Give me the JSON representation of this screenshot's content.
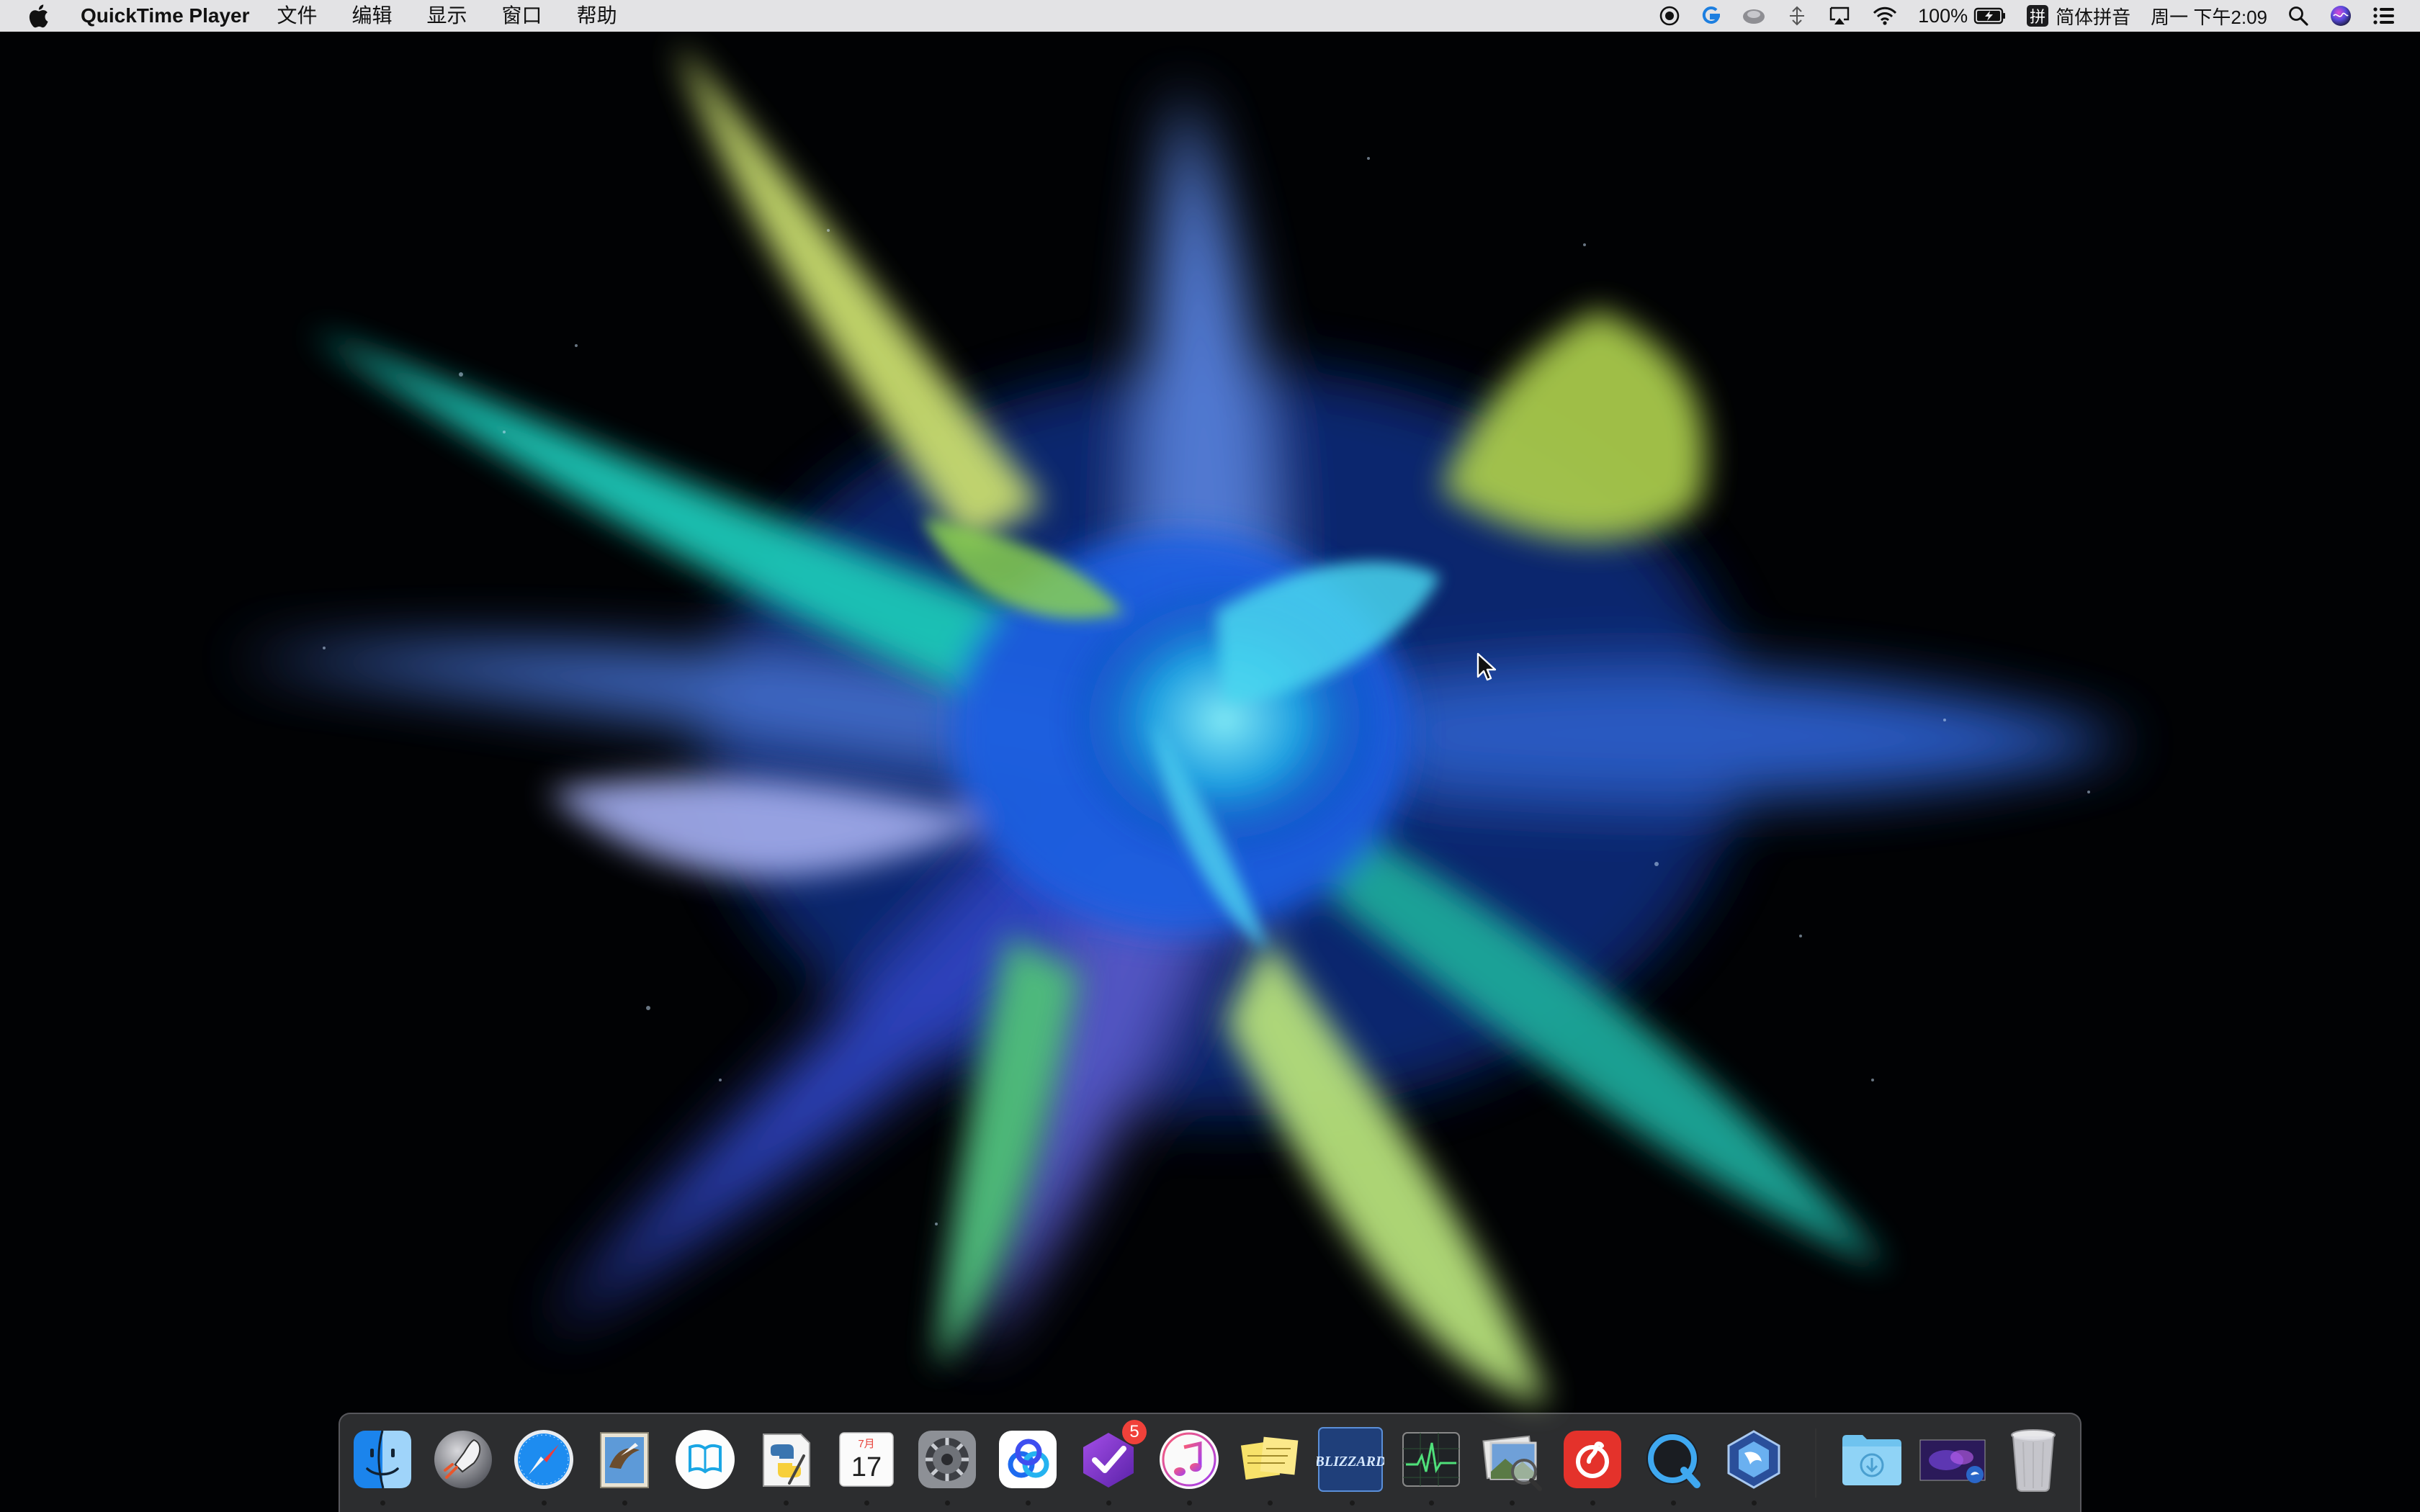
{
  "menubar": {
    "app_name": "QuickTime Player",
    "items": [
      "文件",
      "编辑",
      "显示",
      "窗口",
      "帮助"
    ],
    "battery_percent": "100%",
    "input_method_glyph": "拼",
    "input_method_label": "简体拼音",
    "clock": "周一 下午2:09"
  },
  "dock": {
    "apps": [
      {
        "name": "Finder",
        "icon": "finder-icon",
        "running": true
      },
      {
        "name": "Launchpad",
        "icon": "launchpad-icon",
        "running": false
      },
      {
        "name": "Safari",
        "icon": "safari-icon",
        "running": true
      },
      {
        "name": "Mail",
        "icon": "mail-icon",
        "running": true
      },
      {
        "name": "Reader",
        "icon": "reader-icon",
        "running": false
      },
      {
        "name": "Python Launcher",
        "icon": "python-icon",
        "running": true
      },
      {
        "name": "Calendar",
        "icon": "calendar-icon",
        "running": true
      },
      {
        "name": "System Preferences",
        "icon": "system-preferences-icon",
        "running": true
      },
      {
        "name": "Baidu Netdisk",
        "icon": "baidu-netdisk-icon",
        "running": true
      },
      {
        "name": "OmniFocus",
        "icon": "omnifocus-icon",
        "running": true
      },
      {
        "name": "iTunes",
        "icon": "itunes-icon",
        "running": true
      },
      {
        "name": "Stickies",
        "icon": "stickies-icon",
        "running": true
      },
      {
        "name": "Blizzard",
        "icon": "blizzard-icon",
        "running": true
      },
      {
        "name": "Activity Monitor",
        "icon": "activity-monitor-icon",
        "running": true
      },
      {
        "name": "Preview",
        "icon": "preview-icon",
        "running": true
      },
      {
        "name": "NetEase Music",
        "icon": "netease-music-icon",
        "running": true
      },
      {
        "name": "QuickTime Player",
        "icon": "quicktime-icon",
        "running": true
      },
      {
        "name": "Heroes of the Storm",
        "icon": "heroes-icon",
        "running": true
      }
    ],
    "calendar_month": "7月",
    "calendar_day": "17",
    "omnifocus_badge": "5",
    "blizzard_label": "BLIZZARD",
    "downloads": {
      "name": "Downloads",
      "icon": "downloads-folder-icon"
    },
    "stack": {
      "name": "Desktop Stack",
      "icon": "desktop-stack-icon"
    },
    "trash": {
      "name": "Trash",
      "icon": "trash-icon"
    }
  },
  "colors": {
    "menubar_bg": "#ECECEE",
    "wallpaper_bg": "#010204",
    "badge_red": "#F0413A"
  }
}
